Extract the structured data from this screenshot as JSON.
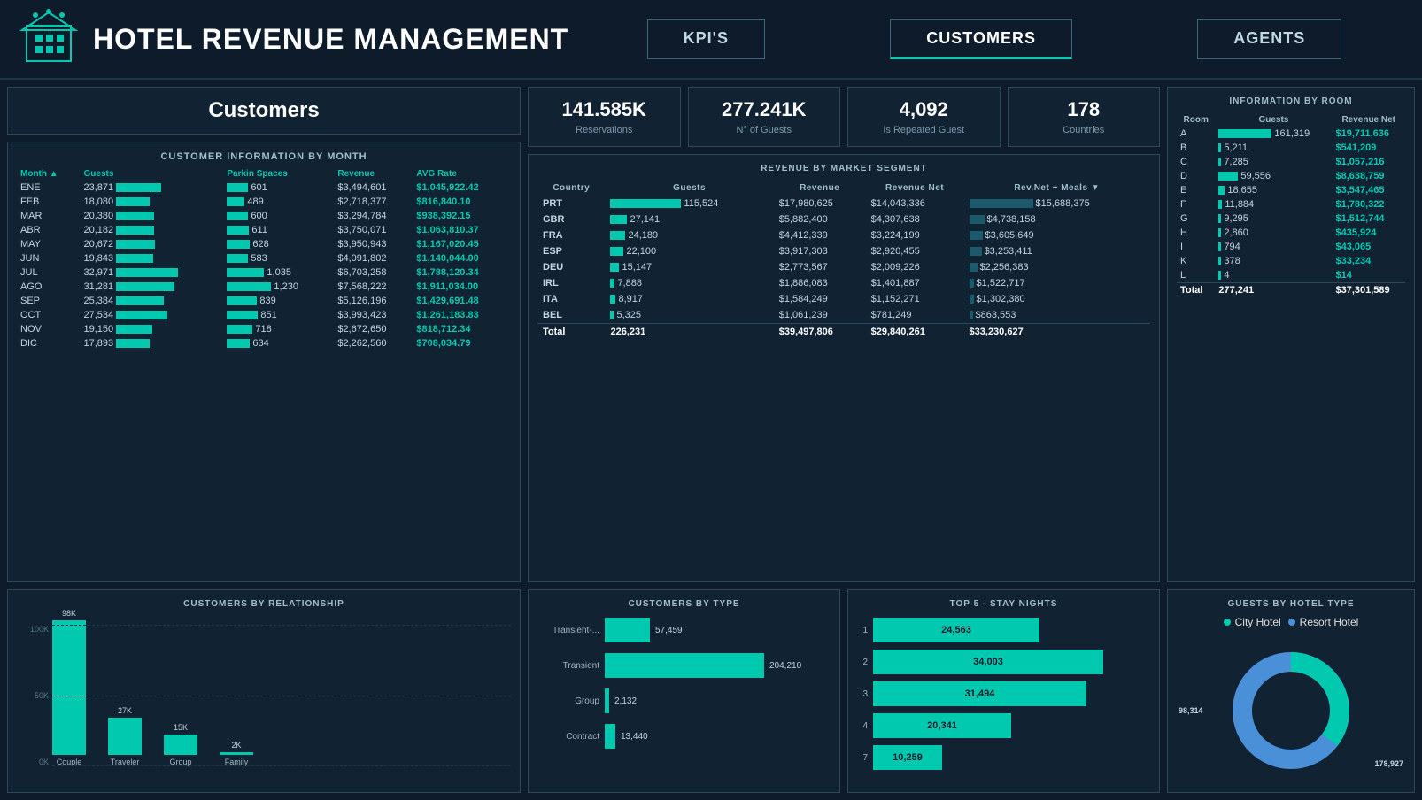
{
  "header": {
    "title": "HOTEL REVENUE MANAGEMENT",
    "nav": [
      "KPI'S",
      "CUSTOMERS",
      "AGENTS"
    ],
    "active_tab": "CUSTOMERS"
  },
  "kpis": [
    {
      "value": "141.585K",
      "label": "Reservations"
    },
    {
      "value": "277.241K",
      "label": "N° of Guests"
    },
    {
      "value": "4,092",
      "label": "Is Repeated Guest"
    },
    {
      "value": "178",
      "label": "Countries"
    }
  ],
  "customers_section": {
    "title": "Customers",
    "table_title": "CUSTOMER INFORMATION BY MONTH",
    "columns": [
      "Month",
      "Guests",
      "Parkin Spaces",
      "Revenue",
      "AVG Rate"
    ],
    "rows": [
      {
        "month": "ENE",
        "guests": "23,871",
        "parking": "601",
        "revenue": "$3,494,601",
        "avg": "$1,045,922.42"
      },
      {
        "month": "FEB",
        "guests": "18,080",
        "parking": "489",
        "revenue": "$2,718,377",
        "avg": "$816,840.10"
      },
      {
        "month": "MAR",
        "guests": "20,380",
        "parking": "600",
        "revenue": "$3,294,784",
        "avg": "$938,392.15"
      },
      {
        "month": "ABR",
        "guests": "20,182",
        "parking": "611",
        "revenue": "$3,750,071",
        "avg": "$1,063,810.37"
      },
      {
        "month": "MAY",
        "guests": "20,672",
        "parking": "628",
        "revenue": "$3,950,943",
        "avg": "$1,167,020.45"
      },
      {
        "month": "JUN",
        "guests": "19,843",
        "parking": "583",
        "revenue": "$4,091,802",
        "avg": "$1,140,044.00"
      },
      {
        "month": "JUL",
        "guests": "32,971",
        "parking": "1,035",
        "revenue": "$6,703,258",
        "avg": "$1,788,120.34"
      },
      {
        "month": "AGO",
        "guests": "31,281",
        "parking": "1,230",
        "revenue": "$7,568,222",
        "avg": "$1,911,034.00"
      },
      {
        "month": "SEP",
        "guests": "25,384",
        "parking": "839",
        "revenue": "$5,126,196",
        "avg": "$1,429,691.48"
      },
      {
        "month": "OCT",
        "guests": "27,534",
        "parking": "851",
        "revenue": "$3,993,423",
        "avg": "$1,261,183.83"
      },
      {
        "month": "NOV",
        "guests": "19,150",
        "parking": "718",
        "revenue": "$2,672,650",
        "avg": "$818,712.34"
      },
      {
        "month": "DIC",
        "guests": "17,893",
        "parking": "634",
        "revenue": "$2,262,560",
        "avg": "$708,034.79"
      }
    ]
  },
  "segment": {
    "title": "REVENUE BY MARKET SEGMENT",
    "columns": [
      "Country",
      "Guests",
      "Revenue",
      "Revenue Net",
      "Rev.Net + Meals"
    ],
    "rows": [
      {
        "country": "PRT",
        "guests": "115,524",
        "revenue": "$17,980,625",
        "rev_net": "$14,043,336",
        "rev_meals": "$15,688,375"
      },
      {
        "country": "GBR",
        "guests": "27,141",
        "revenue": "$5,882,400",
        "rev_net": "$4,307,638",
        "rev_meals": "$4,738,158"
      },
      {
        "country": "FRA",
        "guests": "24,189",
        "revenue": "$4,412,339",
        "rev_net": "$3,224,199",
        "rev_meals": "$3,605,649"
      },
      {
        "country": "ESP",
        "guests": "22,100",
        "revenue": "$3,917,303",
        "rev_net": "$2,920,455",
        "rev_meals": "$3,253,411"
      },
      {
        "country": "DEU",
        "guests": "15,147",
        "revenue": "$2,773,567",
        "rev_net": "$2,009,226",
        "rev_meals": "$2,256,383"
      },
      {
        "country": "IRL",
        "guests": "7,888",
        "revenue": "$1,886,083",
        "rev_net": "$1,401,887",
        "rev_meals": "$1,522,717"
      },
      {
        "country": "ITA",
        "guests": "8,917",
        "revenue": "$1,584,249",
        "rev_net": "$1,152,271",
        "rev_meals": "$1,302,380"
      },
      {
        "country": "BEL",
        "guests": "5,325",
        "revenue": "$1,061,239",
        "rev_net": "$781,249",
        "rev_meals": "$863,553"
      }
    ],
    "total": {
      "country": "Total",
      "guests": "226,231",
      "revenue": "$39,497,806",
      "rev_net": "$29,840,261",
      "rev_meals": "$33,230,627"
    }
  },
  "relationship_chart": {
    "title": "CUSTOMERS BY RELATIONSHIP",
    "bars": [
      {
        "label": "Couple",
        "value": 98000,
        "display": "98K"
      },
      {
        "label": "Traveler",
        "value": 27000,
        "display": "27K"
      },
      {
        "label": "Group",
        "value": 15000,
        "display": "15K"
      },
      {
        "label": "Family",
        "value": 2000,
        "display": "2K"
      }
    ],
    "y_labels": [
      "100K",
      "50K",
      "0K"
    ]
  },
  "type_chart": {
    "title": "CUSTOMERS BY TYPE",
    "bars": [
      {
        "label": "Transient-...",
        "value": 57459,
        "display": "57,459"
      },
      {
        "label": "Transient",
        "value": 204210,
        "display": "204,210"
      },
      {
        "label": "Group",
        "value": 2132,
        "display": "2,132"
      },
      {
        "label": "Contract",
        "value": 13440,
        "display": "13,440"
      }
    ]
  },
  "stay_nights": {
    "title": "TOP 5 - STAY NIGHTS",
    "bars": [
      {
        "rank": "1",
        "value": 24563,
        "display": "24,563"
      },
      {
        "rank": "2",
        "value": 34003,
        "display": "34,003"
      },
      {
        "rank": "3",
        "value": 31494,
        "display": "31,494"
      },
      {
        "rank": "4",
        "value": 20341,
        "display": "20,341"
      },
      {
        "rank": "7",
        "value": 10259,
        "display": "10,259"
      }
    ],
    "max": 34003
  },
  "room_info": {
    "title": "INFORMATION BY ROOM",
    "columns": [
      "Room",
      "Guests",
      "Revenue Net"
    ],
    "rows": [
      {
        "room": "A",
        "guests": "161,319",
        "rev": "$19,711,636"
      },
      {
        "room": "B",
        "guests": "5,211",
        "rev": "$541,209"
      },
      {
        "room": "C",
        "guests": "7,285",
        "rev": "$1,057,216"
      },
      {
        "room": "D",
        "guests": "59,556",
        "rev": "$8,638,759"
      },
      {
        "room": "E",
        "guests": "18,655",
        "rev": "$3,547,465"
      },
      {
        "room": "F",
        "guests": "11,884",
        "rev": "$1,780,322"
      },
      {
        "room": "G",
        "guests": "9,295",
        "rev": "$1,512,744"
      },
      {
        "room": "H",
        "guests": "2,860",
        "rev": "$435,924"
      },
      {
        "room": "I",
        "guests": "794",
        "rev": "$43,065"
      },
      {
        "room": "K",
        "guests": "378",
        "rev": "$33,234"
      },
      {
        "room": "L",
        "guests": "4",
        "rev": "$14"
      }
    ],
    "total": {
      "room": "Total",
      "guests": "277,241",
      "rev": "$37,301,589"
    }
  },
  "hotel_type": {
    "title": "GUESTS BY HOTEL TYPE",
    "legend": [
      "City Hotel",
      "Resort Hotel"
    ],
    "city_value": "98,314",
    "resort_value": "178,927",
    "city_pct": 35,
    "resort_pct": 65
  }
}
